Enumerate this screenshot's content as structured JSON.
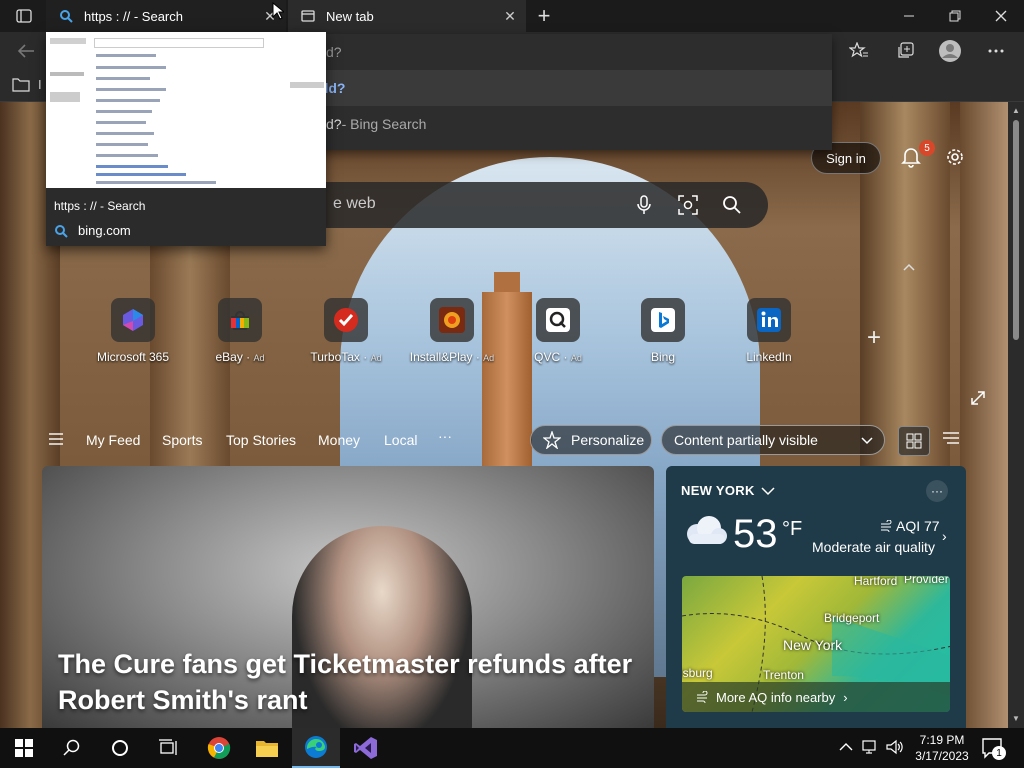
{
  "tabs": [
    {
      "title": "https : // - Search"
    },
    {
      "title": "New tab"
    }
  ],
  "suggestions": {
    "row0": "uild?",
    "row1": "uild?",
    "row2_main": "uild?",
    "row2_suffix": " - Bing Search"
  },
  "favbar": {
    "import_label": "I"
  },
  "page": {
    "signin": "Sign in",
    "notification_count": "5",
    "search_placeholder": "e web",
    "tiles": [
      {
        "label": "Microsoft 365",
        "ad": ""
      },
      {
        "label": "eBay",
        "ad": "Ad"
      },
      {
        "label": "TurboTax",
        "ad": "Ad"
      },
      {
        "label": "Install&Play",
        "ad": "Ad"
      },
      {
        "label": "QVC",
        "ad": "Ad"
      },
      {
        "label": "Bing",
        "ad": ""
      },
      {
        "label": "LinkedIn",
        "ad": ""
      }
    ],
    "nav": [
      "My Feed",
      "Sports",
      "Top Stories",
      "Money",
      "Local"
    ],
    "personalize": "Personalize",
    "content_visibility": "Content partially visible",
    "news_title": "The Cure fans get Ticketmaster refunds after Robert Smith's rant"
  },
  "weather": {
    "location": "NEW YORK",
    "temp": "53",
    "unit": "°F",
    "aqi": "AQI 77",
    "aqi_desc": "Moderate air quality",
    "map_labels": {
      "hartford": "Hartford",
      "providence": "Provider",
      "bridgeport": "Bridgeport",
      "newyork": "New York",
      "trenton": "Trenton",
      "burg": "isburg"
    },
    "more_aq": "More AQ info nearby"
  },
  "preview": {
    "title": "https : // - Search",
    "site": "bing.com"
  },
  "taskbar": {
    "time": "7:19 PM",
    "date": "3/17/2023",
    "notifications": "1"
  },
  "colors": {
    "accent": "#76b9ed",
    "badge": "#d9472b",
    "tab_bg": "#202020"
  }
}
